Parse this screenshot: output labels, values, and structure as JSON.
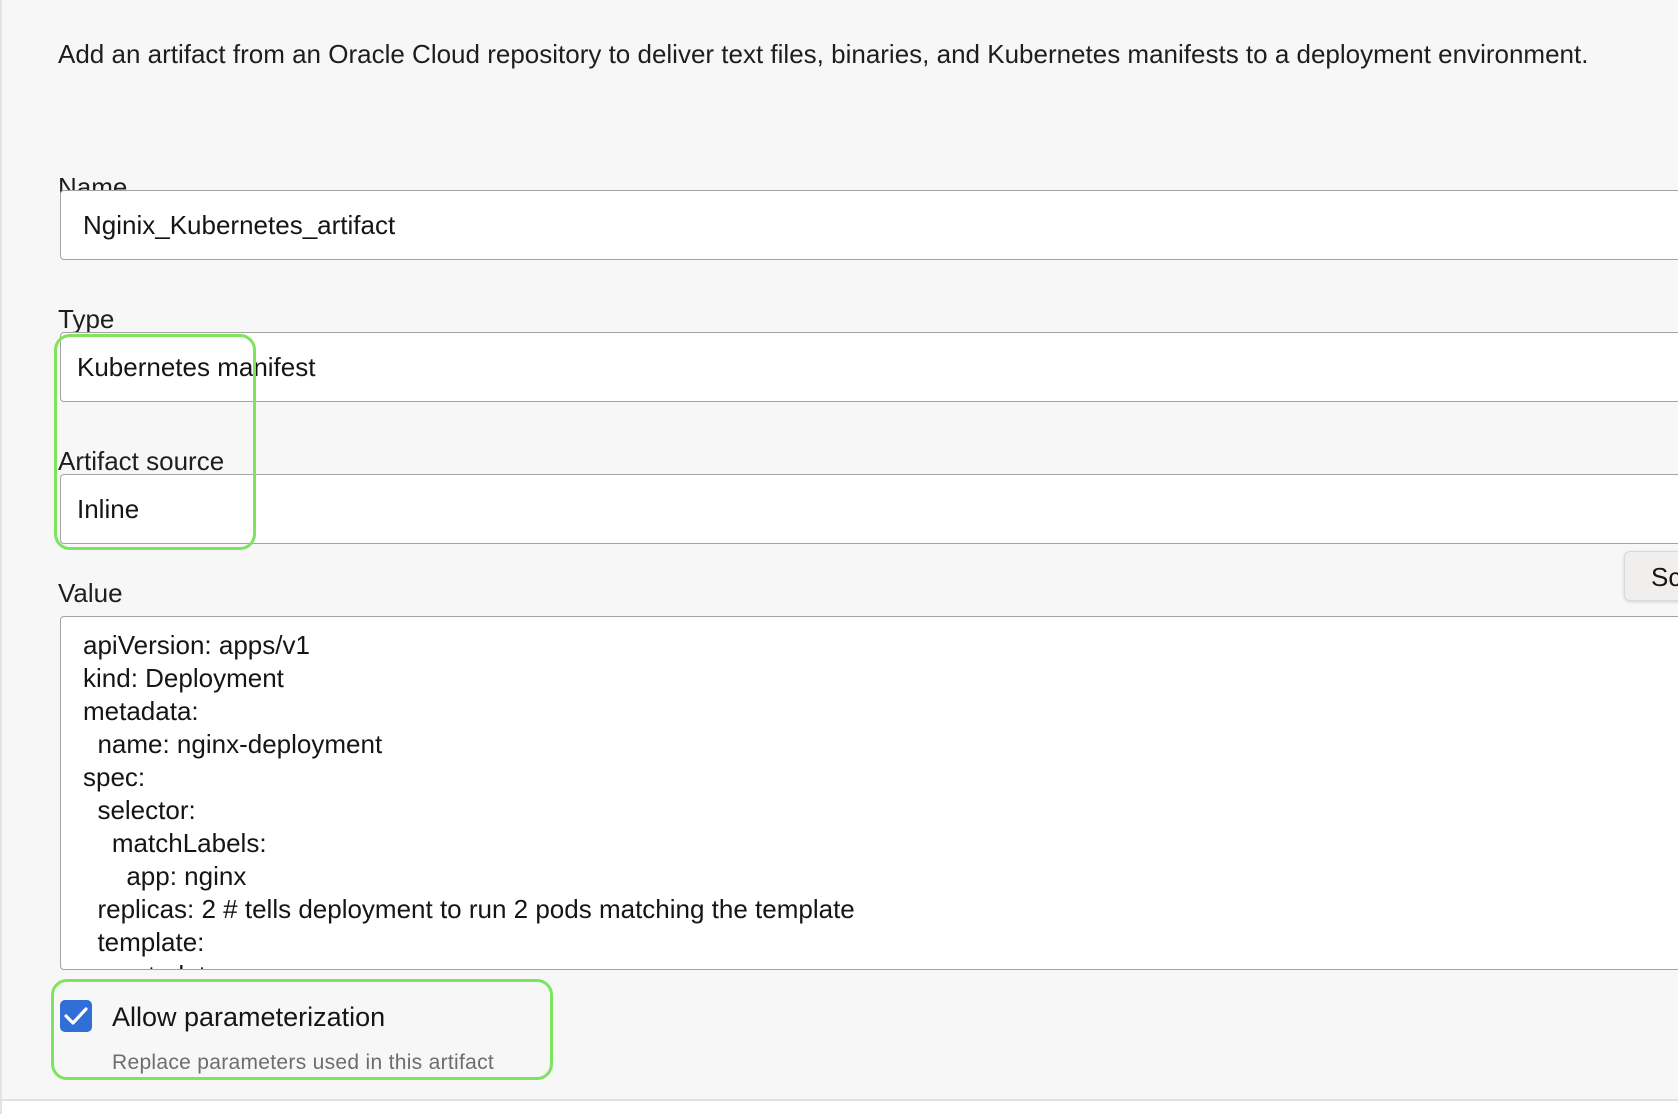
{
  "description": "Add an artifact from an Oracle Cloud repository to deliver text files, binaries, and Kubernetes manifests to a deployment environment.",
  "fields": {
    "name": {
      "label": "Name",
      "value": "Nginix_Kubernetes_artifact"
    },
    "type": {
      "label": "Type",
      "value": "Kubernetes manifest"
    },
    "artifact_source": {
      "label": "Artifact source",
      "value": "Inline"
    },
    "value": {
      "label": "Value",
      "content": "apiVersion: apps/v1\nkind: Deployment\nmetadata:\n  name: nginx-deployment\nspec:\n  selector:\n    matchLabels:\n      app: nginx\n  replicas: 2 # tells deployment to run 2 pods matching the template\n  template:\n    metadata:"
    }
  },
  "side_button": {
    "label": "Sc"
  },
  "parameterization": {
    "checked": true,
    "label": "Allow parameterization",
    "help": "Replace parameters used in this artifact"
  },
  "colors": {
    "highlight": "#7ee35f",
    "checkbox": "#2f6fd6"
  }
}
